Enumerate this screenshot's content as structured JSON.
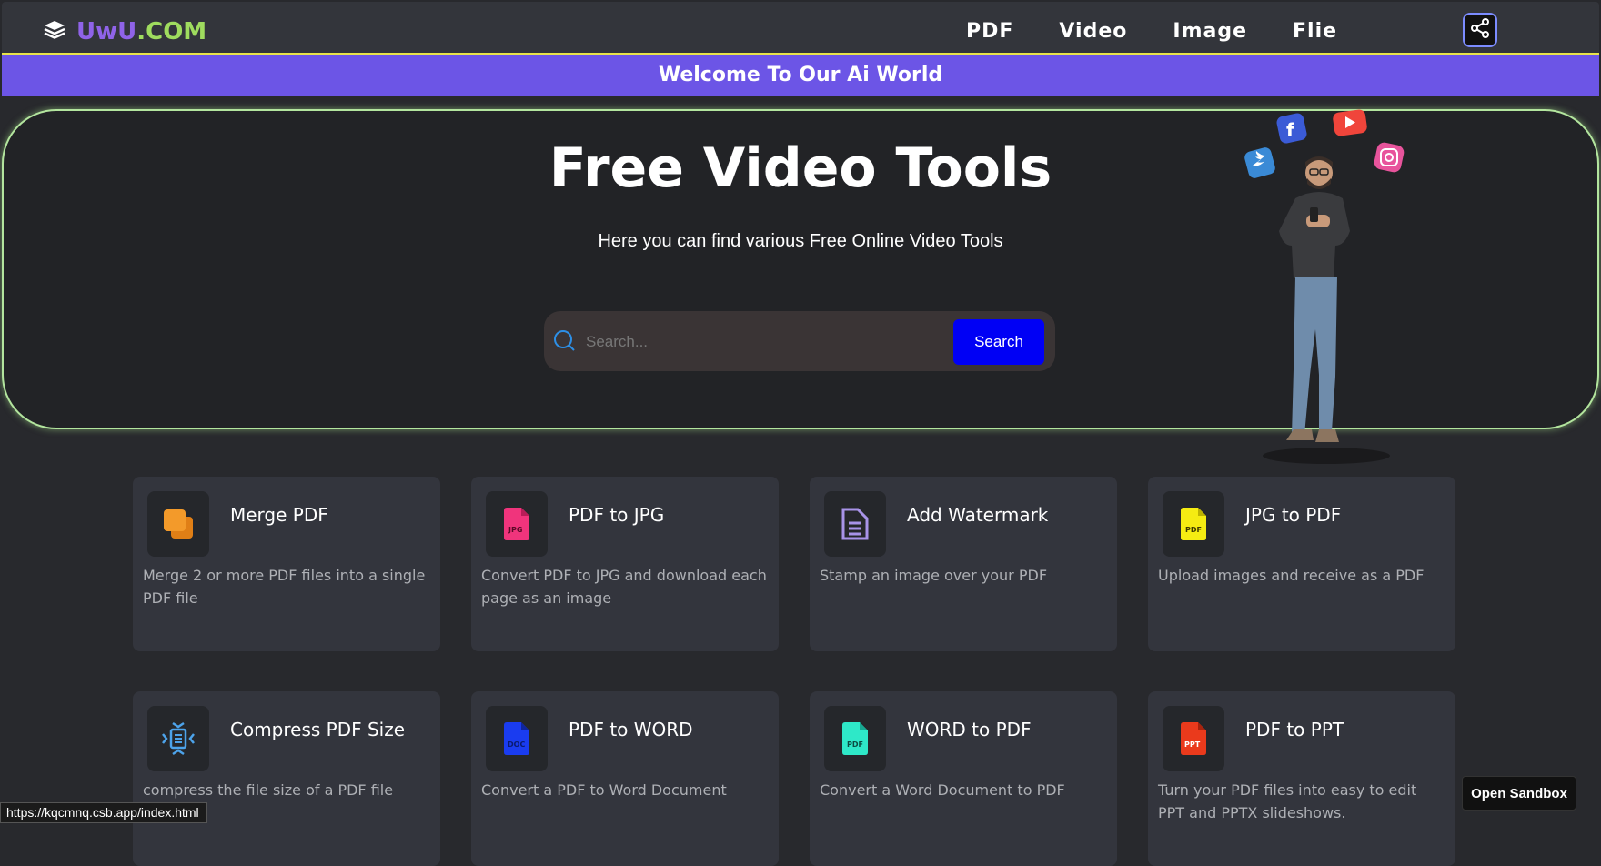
{
  "brand": {
    "name_part1": "UwU",
    "name_part2": ".COM",
    "icon": "layers-icon"
  },
  "nav": {
    "items": [
      "PDF",
      "Video",
      "Image",
      "Flie"
    ],
    "share_icon": "share-icon"
  },
  "banner": {
    "text": "Welcome To Our Ai World"
  },
  "hero": {
    "title": "Free Video Tools",
    "subtitle": "Here you can find various Free Online Video Tools",
    "search": {
      "placeholder": "Search...",
      "button": "Search"
    }
  },
  "cards": [
    {
      "title": "Merge PDF",
      "desc": "Merge 2 or more PDF files into a single PDF file",
      "icon": "merge-icon",
      "color": "#f39a2a"
    },
    {
      "title": "PDF to JPG",
      "desc": "Convert PDF to JPG and download each page as an image",
      "icon": "jpg-file-icon",
      "icon_text": "JPG",
      "color": "#f0347c"
    },
    {
      "title": "Add Watermark",
      "desc": "Stamp an image over your PDF",
      "icon": "document-icon",
      "color": "#a893e8"
    },
    {
      "title": "JPG to PDF",
      "desc": "Upload images and receive as a PDF",
      "icon": "pdf-file-icon",
      "icon_text": "PDF",
      "color": "#f5ec12"
    },
    {
      "title": "Compress PDF Size",
      "desc": "compress the file size of a PDF file",
      "icon": "compress-icon",
      "color": "#4da3ea"
    },
    {
      "title": "PDF to WORD",
      "desc": "Convert a PDF to Word Document",
      "icon": "doc-file-icon",
      "icon_text": "DOC",
      "color": "#1a3cf0"
    },
    {
      "title": "WORD to PDF",
      "desc": "Convert a Word Document to PDF",
      "icon": "pdf-file-icon",
      "icon_text": "PDF",
      "color": "#2ee8c8"
    },
    {
      "title": "PDF to PPT",
      "desc": "Turn your PDF files into easy to edit PPT and PPTX slideshows.",
      "icon": "ppt-file-icon",
      "icon_text": "PPT",
      "color": "#ea3a1c"
    }
  ],
  "statusbar": {
    "url": "https://kqcmnq.csb.app/index.html"
  },
  "sandbox_button": {
    "label": "Open Sandbox"
  }
}
